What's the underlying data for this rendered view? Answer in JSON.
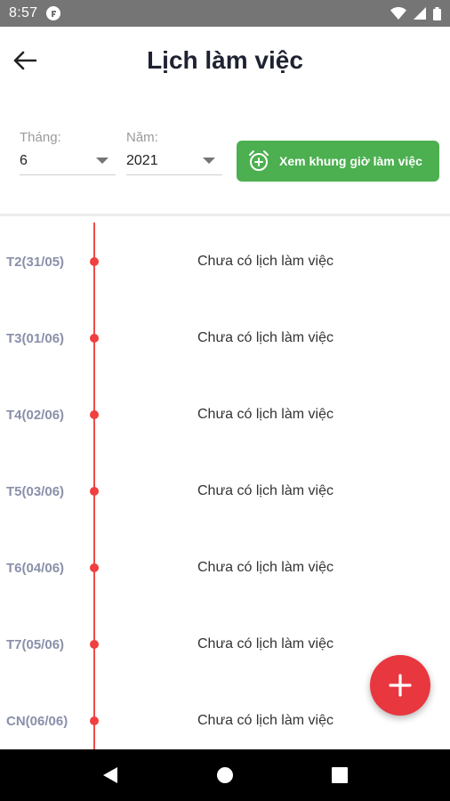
{
  "status_bar": {
    "time": "8:57"
  },
  "header": {
    "title": "Lịch làm việc"
  },
  "filters": {
    "month_label": "Tháng:",
    "month_value": "6",
    "year_label": "Năm:",
    "year_value": "2021",
    "view_button_label": "Xem khung giờ làm việc"
  },
  "schedule": [
    {
      "date": "T2(31/05)",
      "text": "Chưa có lịch làm việc"
    },
    {
      "date": "T3(01/06)",
      "text": "Chưa có lịch làm việc"
    },
    {
      "date": "T4(02/06)",
      "text": "Chưa có lịch làm việc"
    },
    {
      "date": "T5(03/06)",
      "text": "Chưa có lịch làm việc"
    },
    {
      "date": "T6(04/06)",
      "text": "Chưa có lịch làm việc"
    },
    {
      "date": "T7(05/06)",
      "text": "Chưa có lịch làm việc"
    },
    {
      "date": "CN(06/06)",
      "text": "Chưa có lịch làm việc"
    }
  ],
  "colors": {
    "accent_green": "#4caf50",
    "timeline_red": "#ef4b4b",
    "fab_red": "#e8373f"
  },
  "icons": [
    "back-arrow-icon",
    "alarm-icon",
    "plus-icon",
    "wifi-icon",
    "signal-icon",
    "battery-icon"
  ]
}
